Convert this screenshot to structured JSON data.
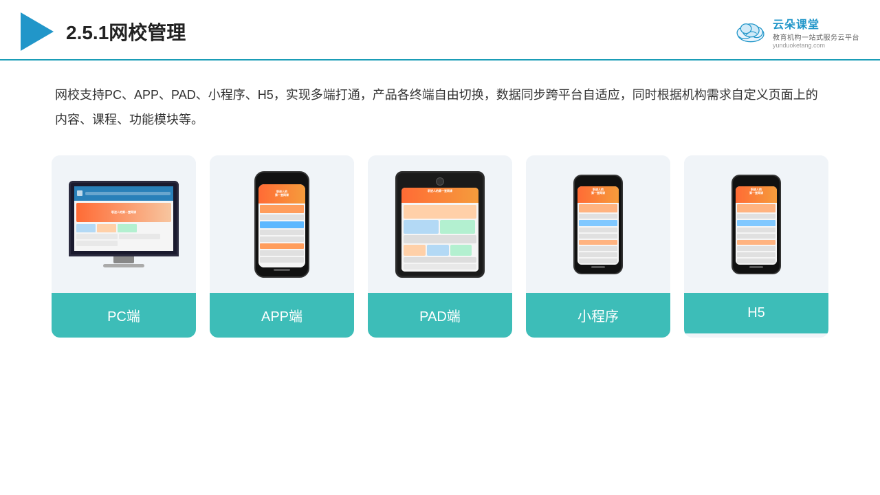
{
  "header": {
    "title": "2.5.1网校管理",
    "brand": {
      "name": "云朵课堂",
      "slogan": "教育机构一站式服务云平台",
      "url": "yunduoketang.com"
    }
  },
  "description": "网校支持PC、APP、PAD、小程序、H5，实现多端打通，产品各终端自由切换，数据同步跨平台自适应，同时根据机构需求自定义页面上的内容、课程、功能模块等。",
  "cards": [
    {
      "id": "pc",
      "label": "PC端"
    },
    {
      "id": "app",
      "label": "APP端"
    },
    {
      "id": "pad",
      "label": "PAD端"
    },
    {
      "id": "mini",
      "label": "小程序"
    },
    {
      "id": "h5",
      "label": "H5"
    }
  ],
  "colors": {
    "accent": "#2196c9",
    "teal": "#3dbdb8",
    "headerBorder": "#1a9db7"
  }
}
